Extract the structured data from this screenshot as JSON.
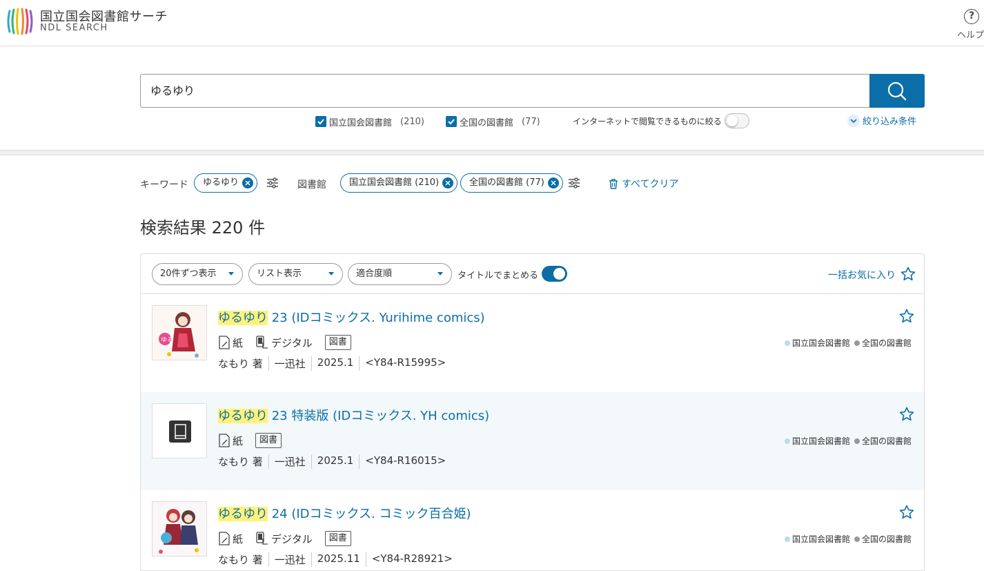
{
  "header": {
    "brand_ja": "国立国会図書館サーチ",
    "brand_en": "NDL SEARCH",
    "help_label": "ヘルプ"
  },
  "search": {
    "query": "ゆるゆり",
    "scope_ndl": "国立国会図書館",
    "scope_ndl_count": "(210)",
    "scope_all": "全国の図書館",
    "scope_all_count": "(77)",
    "internet_only": "インターネットで閲覧できるものに絞る",
    "filter_conditions": "絞り込み条件"
  },
  "facets": {
    "keyword_label": "キーワード",
    "keyword_value": "ゆるゆり",
    "library_label": "図書館",
    "library_ndl": "国立国会図書館 (210)",
    "library_all": "全国の図書館 (77)",
    "clear_all": "すべてクリア"
  },
  "results": {
    "count_text": "検索結果 220 件",
    "per_page": "20件ずつ表示",
    "view_mode": "リスト表示",
    "sort": "適合度順",
    "group_by_title": "タイトルでまとめる",
    "bulk_favorite": "一括お気に入り",
    "items": [
      {
        "title_highlight": "ゆるゆり",
        "title_rest": " 23 (IDコミックス. Yurihime comics)",
        "format_paper": "紙",
        "format_digital": "デジタル",
        "type": "図書",
        "author": "なもり 著",
        "publisher": "一迅社",
        "date": "2025.1",
        "id": "<Y84-R15995>",
        "holding_ndl": "国立国会図書館",
        "holding_all": "全国の図書館"
      },
      {
        "title_highlight": "ゆるゆり",
        "title_rest": " 23 特装版 (IDコミックス. YH comics)",
        "format_paper": "紙",
        "type": "図書",
        "author": "なもり 著",
        "publisher": "一迅社",
        "date": "2025.1",
        "id": "<Y84-R16015>",
        "holding_ndl": "国立国会図書館",
        "holding_all": "全国の図書館"
      },
      {
        "title_highlight": "ゆるゆり",
        "title_rest": " 24 (IDコミックス. コミック百合姫)",
        "format_paper": "紙",
        "format_digital": "デジタル",
        "type": "図書",
        "author": "なもり 著",
        "publisher": "一迅社",
        "date": "2025.11",
        "id": "<Y84-R28921>",
        "holding_ndl": "国立国会図書館",
        "holding_all": "全国の図書館"
      }
    ]
  },
  "colors": {
    "accent": "#0b6ea8",
    "highlight": "#fff27a",
    "dot_ndl": "#b9dcef",
    "dot_all": "#999999"
  }
}
